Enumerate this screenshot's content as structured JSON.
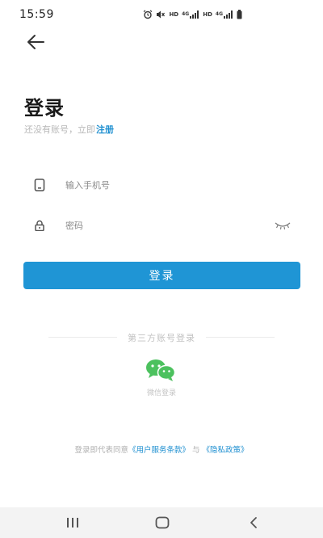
{
  "status_bar": {
    "time": "15:59",
    "icons": [
      "alarm-icon",
      "mute-icon",
      "hd-label",
      "4g-signal-icon",
      "hd-label",
      "4g-signal-icon",
      "battery-icon"
    ],
    "hd_label": "HD",
    "network_label": "4G"
  },
  "header": {
    "back_icon": "back-arrow-icon"
  },
  "login": {
    "title": "登录",
    "no_account_text": "还没有账号，立即",
    "register_link": "注册",
    "phone_placeholder": "输入手机号",
    "phone_value": "",
    "password_placeholder": "密码",
    "password_value": "",
    "submit_label": "登录"
  },
  "third_party": {
    "title": "第三方账号登录",
    "wechat_label": "微信登录",
    "wechat_color": "#4cc15e"
  },
  "agreement": {
    "prefix": "登录即代表同意",
    "terms_link": "《用户服务条款》",
    "conjunction": "与",
    "privacy_link": "《隐私政策》"
  },
  "nav_bar": {
    "buttons": [
      "recents-icon",
      "home-icon",
      "back-icon"
    ]
  },
  "colors": {
    "accent": "#1f95d5",
    "link": "#1e8fd0",
    "wechat": "#4cc15e"
  }
}
